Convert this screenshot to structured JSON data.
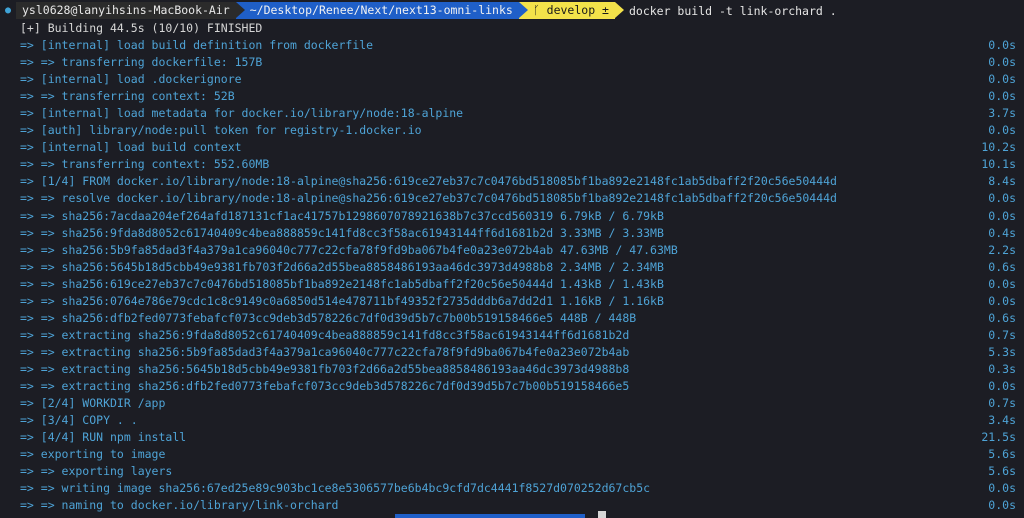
{
  "prompt": {
    "user_host": "ysl0628@lanyihsins-MacBook-Air",
    "path": "~/Desktop/Renee/Next/next13-omni-links",
    "git_branch": "develop ±",
    "command": "docker build -t link-orchard ."
  },
  "header": "[+] Building 44.5s (10/10) FINISHED",
  "lines": [
    {
      "text": "=> [internal] load build definition from dockerfile",
      "time": "0.0s"
    },
    {
      "text": "=> => transferring dockerfile: 157B",
      "time": "0.0s"
    },
    {
      "text": "=> [internal] load .dockerignore",
      "time": "0.0s"
    },
    {
      "text": "=> => transferring context: 52B",
      "time": "0.0s"
    },
    {
      "text": "=> [internal] load metadata for docker.io/library/node:18-alpine",
      "time": "3.7s"
    },
    {
      "text": "=> [auth] library/node:pull token for registry-1.docker.io",
      "time": "0.0s"
    },
    {
      "text": "=> [internal] load build context",
      "time": "10.2s"
    },
    {
      "text": "=> => transferring context: 552.60MB",
      "time": "10.1s"
    },
    {
      "text": "=> [1/4] FROM docker.io/library/node:18-alpine@sha256:619ce27eb37c7c0476bd518085bf1ba892e2148fc1ab5dbaff2f20c56e50444d",
      "time": "8.4s"
    },
    {
      "text": "=> => resolve docker.io/library/node:18-alpine@sha256:619ce27eb37c7c0476bd518085bf1ba892e2148fc1ab5dbaff2f20c56e50444d",
      "time": "0.0s"
    },
    {
      "text": "=> => sha256:7acdaa204ef264afd187131cf1ac41757b1298607078921638b7c37ccd560319 6.79kB / 6.79kB",
      "time": "0.0s"
    },
    {
      "text": "=> => sha256:9fda8d8052c61740409c4bea888859c141fd8cc3f58ac61943144ff6d1681b2d 3.33MB / 3.33MB",
      "time": "0.4s"
    },
    {
      "text": "=> => sha256:5b9fa85dad3f4a379a1ca96040c777c22cfa78f9fd9ba067b4fe0a23e072b4ab 47.63MB / 47.63MB",
      "time": "2.2s"
    },
    {
      "text": "=> => sha256:5645b18d5cbb49e9381fb703f2d66a2d55bea8858486193aa46dc3973d4988b8 2.34MB / 2.34MB",
      "time": "0.6s"
    },
    {
      "text": "=> => sha256:619ce27eb37c7c0476bd518085bf1ba892e2148fc1ab5dbaff2f20c56e50444d 1.43kB / 1.43kB",
      "time": "0.0s"
    },
    {
      "text": "=> => sha256:0764e786e79cdc1c8c9149c0a6850d514e478711bf49352f2735dddb6a7dd2d1 1.16kB / 1.16kB",
      "time": "0.0s"
    },
    {
      "text": "=> => sha256:dfb2fed0773febafcf073cc9deb3d578226c7df0d39d5b7c7b00b519158466e5 448B / 448B",
      "time": "0.6s"
    },
    {
      "text": "=> => extracting sha256:9fda8d8052c61740409c4bea888859c141fd8cc3f58ac61943144ff6d1681b2d",
      "time": "0.7s"
    },
    {
      "text": "=> => extracting sha256:5b9fa85dad3f4a379a1ca96040c777c22cfa78f9fd9ba067b4fe0a23e072b4ab",
      "time": "5.3s"
    },
    {
      "text": "=> => extracting sha256:5645b18d5cbb49e9381fb703f2d66a2d55bea8858486193aa46dc3973d4988b8",
      "time": "0.3s"
    },
    {
      "text": "=> => extracting sha256:dfb2fed0773febafcf073cc9deb3d578226c7df0d39d5b7c7b00b519158466e5",
      "time": "0.0s"
    },
    {
      "text": "=> [2/4] WORKDIR /app",
      "time": "0.7s"
    },
    {
      "text": "=> [3/4] COPY . .",
      "time": "3.4s"
    },
    {
      "text": "=> [4/4] RUN npm install",
      "time": "21.5s"
    },
    {
      "text": "=> exporting to image",
      "time": "5.6s"
    },
    {
      "text": "=> => exporting layers",
      "time": "5.6s"
    },
    {
      "text": "=> => writing image sha256:67ed25e89c903bc1ce8e5306577be6b4bc9cfd7dc4441f8527d070252d67cb5c",
      "time": "0.0s"
    },
    {
      "text": "=> => naming to docker.io/library/link-orchard",
      "time": "0.0s"
    }
  ]
}
